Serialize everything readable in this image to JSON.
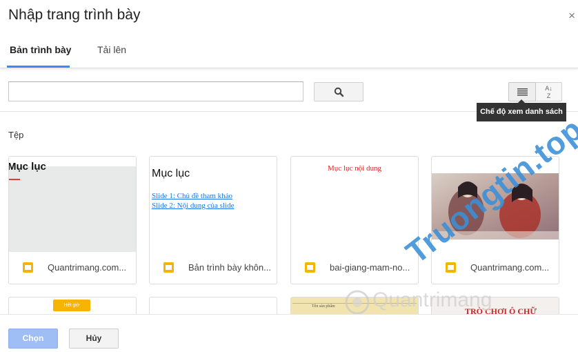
{
  "dialog": {
    "title": "Nhập trang trình bày",
    "close_symbol": "×"
  },
  "tabs": [
    {
      "label": "Bản trình bày",
      "active": true
    },
    {
      "label": "Tải lên",
      "active": false
    }
  ],
  "search": {
    "value": "",
    "placeholder": ""
  },
  "toolbar": {
    "list_view_icon": "list-view-icon",
    "sort_icon": "sort-az-icon",
    "sort_top": "A",
    "sort_bottom": "Z",
    "tooltip": "Chế độ xem danh sách"
  },
  "section": {
    "label": "Tệp"
  },
  "files": [
    {
      "name": "Quantrimang.com...",
      "thumb_title": "Mục lục"
    },
    {
      "name": "Bản trình bày khôn...",
      "thumb_title": "Mục lục",
      "thumb_links": [
        "Slide 1: Chủ đề tham khảo",
        "Slide 2: Nội dung của slide"
      ]
    },
    {
      "name": "bai-giang-mam-no...",
      "thumb_title": "Mục lục nội dung"
    },
    {
      "name": "Quantrimang.com..."
    }
  ],
  "partial_files": [
    {
      "thumb_label": "Hết giờ"
    },
    {
      "thumb_label": ""
    },
    {
      "thumb_label": "Tên sản phẩm"
    },
    {
      "thumb_label": "TRÒ CHƠI Ô CHỮ"
    }
  ],
  "footer": {
    "choose_label": "Chọn",
    "cancel_label": "Hủy"
  },
  "watermark": {
    "text": "Truongtin.top",
    "subtext": "Quantrimang"
  },
  "colors": {
    "accent": "#4285f4",
    "slides_icon": "#f4b400",
    "choose_disabled": "#9fbef5"
  }
}
